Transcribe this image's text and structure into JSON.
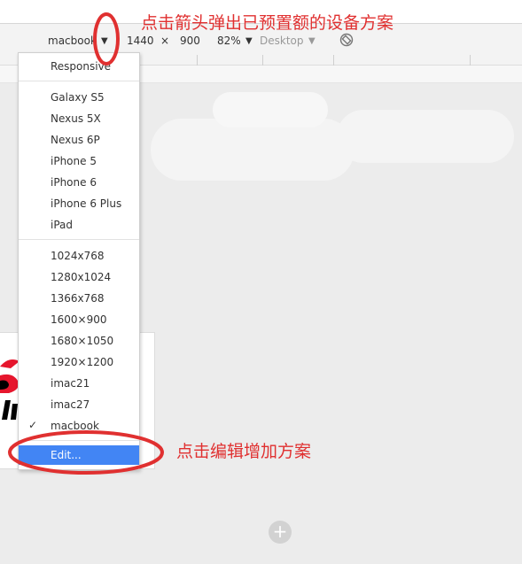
{
  "toolbar": {
    "device": "macbook",
    "width": "1440",
    "times": "×",
    "height": "900",
    "zoom": "82%",
    "mode": "Desktop",
    "arrow_glyph": "▼"
  },
  "dropdown": {
    "top_item": "Responsive",
    "group_devices": [
      "Galaxy S5",
      "Nexus 5X",
      "Nexus 6P",
      "iPhone 5",
      "iPhone 6",
      "iPhone 6 Plus",
      "iPad"
    ],
    "group_sizes": [
      "1024x768",
      "1280x1024",
      "1366x768",
      "1600×900",
      "1680×1050",
      "1920×1200",
      "imac21",
      "imac27",
      "macbook"
    ],
    "checked_item": "macbook",
    "check_glyph": "✓",
    "edit_item": "Edit..."
  },
  "annotations": {
    "top": "点击箭头弹出已预置额的设备方案",
    "bottom": "点击编辑增加方案"
  },
  "colors": {
    "accent": "#4285f4",
    "annotation_red": "#e03030"
  },
  "icons": {
    "rotate": "rotate-icon",
    "add": "plus-icon",
    "check": "checkmark-icon",
    "logo": "weibo-logo"
  }
}
